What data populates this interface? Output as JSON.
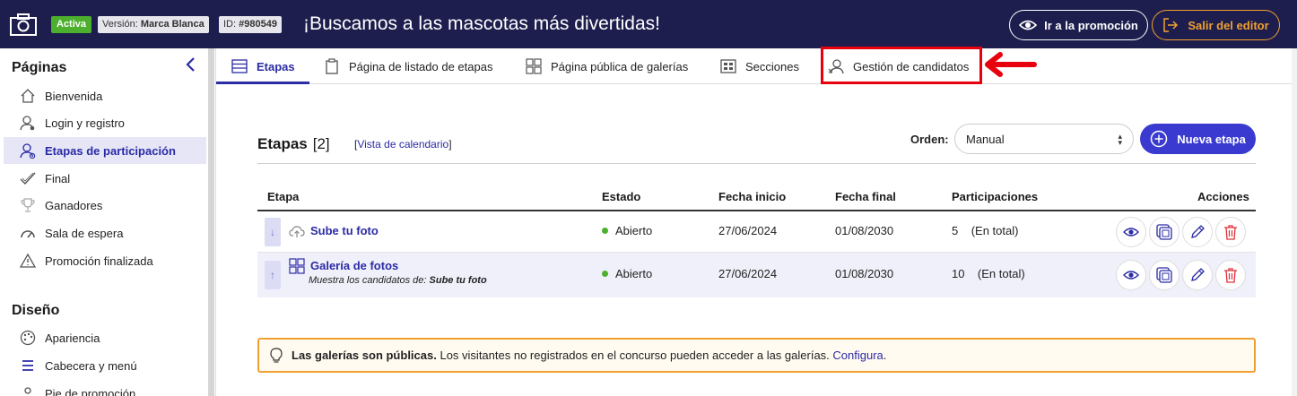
{
  "topbar": {
    "status_badge": "Activa",
    "version_label": "Versión:",
    "version_value": "Marca Blanca",
    "id_label": "ID:",
    "id_value": "#980549",
    "promo_title": "¡Buscamos a las mascotas más divertidas!",
    "go_button": "Ir a la promoción",
    "exit_button": "Salir del editor",
    "icons": [
      "camera-icon",
      "eye-icon",
      "exit-icon"
    ]
  },
  "sidebar": {
    "pages_heading": "Páginas",
    "items": [
      {
        "label": "Bienvenida",
        "icon": "home-icon"
      },
      {
        "label": "Login y registro",
        "icon": "user-login-icon"
      },
      {
        "label": "Etapas de participación",
        "icon": "user-stages-icon",
        "active": true
      },
      {
        "label": "Final",
        "icon": "check-icon"
      },
      {
        "label": "Ganadores",
        "icon": "trophy-icon"
      },
      {
        "label": "Sala de espera",
        "icon": "gauge-icon"
      },
      {
        "label": "Promoción finalizada",
        "icon": "warning-icon"
      }
    ],
    "design_heading": "Diseño",
    "design_items": [
      {
        "label": "Apariencia",
        "icon": "palette-icon"
      },
      {
        "label": "Cabecera y menú",
        "icon": "menu-icon"
      },
      {
        "label": "Pie de promoción",
        "icon": "footer-icon"
      }
    ]
  },
  "tabs": [
    {
      "label": "Etapas",
      "icon": "list-icon",
      "active": true
    },
    {
      "label": "Página de listado de etapas",
      "icon": "clipboard-icon"
    },
    {
      "label": "Página pública de galerías",
      "icon": "grid-icon"
    },
    {
      "label": "Secciones",
      "icon": "layout-icon"
    },
    {
      "label": "Gestión de candidatos",
      "icon": "candidates-icon"
    }
  ],
  "main": {
    "title": "Etapas",
    "count": "[2]",
    "calendar_link": "Vista de calendario",
    "order_label": "Orden:",
    "order_value": "Manual",
    "new_button": "Nueva etapa",
    "columns": [
      "Etapa",
      "Estado",
      "Fecha inicio",
      "Fecha final",
      "Participaciones",
      "Acciones"
    ],
    "rows": [
      {
        "name": "Sube tu foto",
        "subtitle_prefix": "",
        "subtitle_value": "",
        "status": "Abierto",
        "start": "27/06/2024",
        "end": "01/08/2030",
        "participations": "5",
        "participations_note": "(En total)",
        "handle": "↓",
        "icon": "upload-cloud-icon"
      },
      {
        "name": "Galería de fotos",
        "subtitle_prefix": "Muestra los candidatos de:",
        "subtitle_value": "Sube tu foto",
        "status": "Abierto",
        "start": "27/06/2024",
        "end": "01/08/2030",
        "participations": "10",
        "participations_note": "(En total)",
        "handle": "↑",
        "icon": "gallery-grid-icon"
      }
    ],
    "action_icons": [
      "eye-icon",
      "copy-icon",
      "edit-icon",
      "trash-icon"
    ]
  },
  "alert": {
    "bold": "Las galerías son públicas.",
    "text": "Los visitantes no registrados en el concurso pueden acceder a las galerías.",
    "link": "Configura",
    "end": "."
  },
  "colors": {
    "topbar": "#1e1e4e",
    "accent": "#2b2ba6",
    "primary_button": "#3a3ad0",
    "active_badge": "#4caf2d",
    "warning": "#f0a030",
    "highlight": "#e8000f"
  }
}
